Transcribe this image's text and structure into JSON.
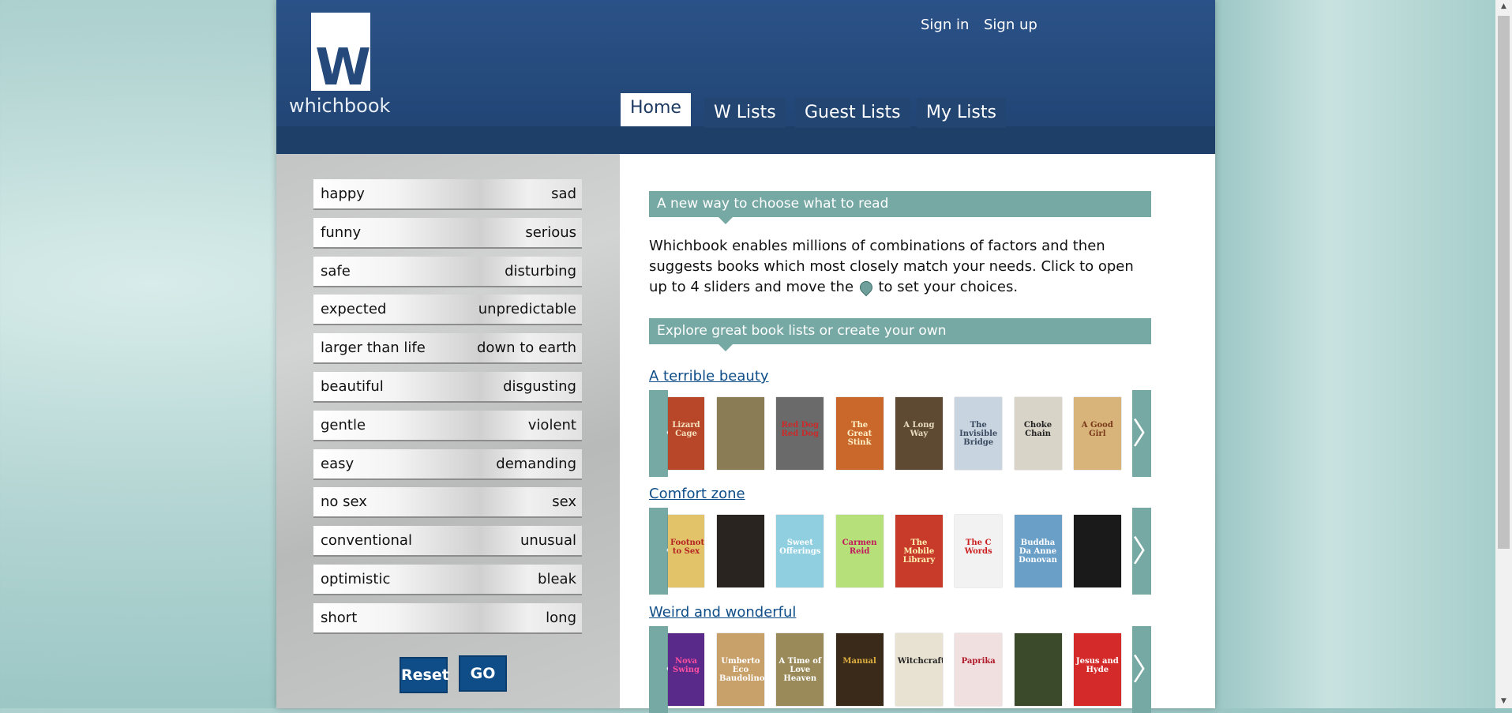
{
  "brand": {
    "logo_letter": "W",
    "name": "whichbook"
  },
  "auth": {
    "sign_in": "Sign in",
    "sign_up": "Sign up"
  },
  "tabs": [
    {
      "label": "Home",
      "active": true
    },
    {
      "label": "W Lists"
    },
    {
      "label": "Guest Lists"
    },
    {
      "label": "My Lists"
    }
  ],
  "sliders": [
    {
      "left": "happy",
      "right": "sad"
    },
    {
      "left": "funny",
      "right": "serious"
    },
    {
      "left": "safe",
      "right": "disturbing"
    },
    {
      "left": "expected",
      "right": "unpredictable"
    },
    {
      "left": "larger than life",
      "right": "down to earth"
    },
    {
      "left": "beautiful",
      "right": "disgusting"
    },
    {
      "left": "gentle",
      "right": "violent"
    },
    {
      "left": "easy",
      "right": "demanding"
    },
    {
      "left": "no sex",
      "right": "sex"
    },
    {
      "left": "conventional",
      "right": "unusual"
    },
    {
      "left": "optimistic",
      "right": "bleak"
    },
    {
      "left": "short",
      "right": "long"
    }
  ],
  "buttons": {
    "reset": "Reset",
    "go": "GO"
  },
  "sections": {
    "intro_title": "A new way to choose what to read",
    "intro_text_1": "Whichbook enables millions of combinations of factors and then suggests books which most closely match your needs. Click to open up to 4 sliders and move the",
    "intro_text_2": "to set your choices.",
    "explore_title": "Explore great book lists or create your own"
  },
  "lists": [
    {
      "title": "A terrible beauty",
      "books": [
        {
          "cover_text": "Lizard Cage",
          "color": "#b8472a",
          "text_color": "#f5e3c0"
        },
        {
          "cover_text": "",
          "color": "#8a7d55",
          "text_color": "#fff"
        },
        {
          "cover_text": "Red Dog Red Dog",
          "color": "#6a6a6a",
          "text_color": "#c92a2a"
        },
        {
          "cover_text": "The Great Stink",
          "color": "#c9682a",
          "text_color": "#fff0c8"
        },
        {
          "cover_text": "A Long Way",
          "color": "#5e4a32",
          "text_color": "#e8dcc0"
        },
        {
          "cover_text": "The Invisible Bridge",
          "color": "#c8d4e0",
          "text_color": "#3a4a60"
        },
        {
          "cover_text": "Choke Chain",
          "color": "#d9d4c8",
          "text_color": "#222"
        },
        {
          "cover_text": "A Good Girl",
          "color": "#d8b47a",
          "text_color": "#7a3a1a"
        }
      ]
    },
    {
      "title": "Comfort zone",
      "books": [
        {
          "cover_text": "Footnotes to Sex",
          "color": "#e3c36a",
          "text_color": "#b22222"
        },
        {
          "cover_text": "",
          "color": "#2a2420",
          "text_color": "#fff"
        },
        {
          "cover_text": "Sweet Offerings",
          "color": "#8fcfe0",
          "text_color": "#ffffff"
        },
        {
          "cover_text": "Carmen Reid",
          "color": "#b6e07a",
          "text_color": "#c2185b"
        },
        {
          "cover_text": "The Mobile Library",
          "color": "#c83a2a",
          "text_color": "#fff2b0"
        },
        {
          "cover_text": "The C Words",
          "color": "#f2f2f2",
          "text_color": "#cc1f1f"
        },
        {
          "cover_text": "Buddha Da Anne Donovan",
          "color": "#6a9fc8",
          "text_color": "#ffffff"
        },
        {
          "cover_text": "",
          "color": "#1a1a1a",
          "text_color": "#fff"
        }
      ]
    },
    {
      "title": "Weird and wonderful",
      "books": [
        {
          "cover_text": "Nova Swing",
          "color": "#5a2a8a",
          "text_color": "#ff4fa0"
        },
        {
          "cover_text": "Umberto Eco Baudolino",
          "color": "#c8a06a",
          "text_color": "#fff"
        },
        {
          "cover_text": "A Time of Love Heaven",
          "color": "#9a8a5a",
          "text_color": "#fff"
        },
        {
          "cover_text": "Manual",
          "color": "#3a2a1a",
          "text_color": "#e0b040"
        },
        {
          "cover_text": "Witchcraft",
          "color": "#e8e2d2",
          "text_color": "#222"
        },
        {
          "cover_text": "Paprika",
          "color": "#f0e0e0",
          "text_color": "#b01a2a"
        },
        {
          "cover_text": "",
          "color": "#3a4a2a",
          "text_color": "#fff"
        },
        {
          "cover_text": "Jesus and Hyde",
          "color": "#d42a2a",
          "text_color": "#fff"
        }
      ]
    }
  ]
}
